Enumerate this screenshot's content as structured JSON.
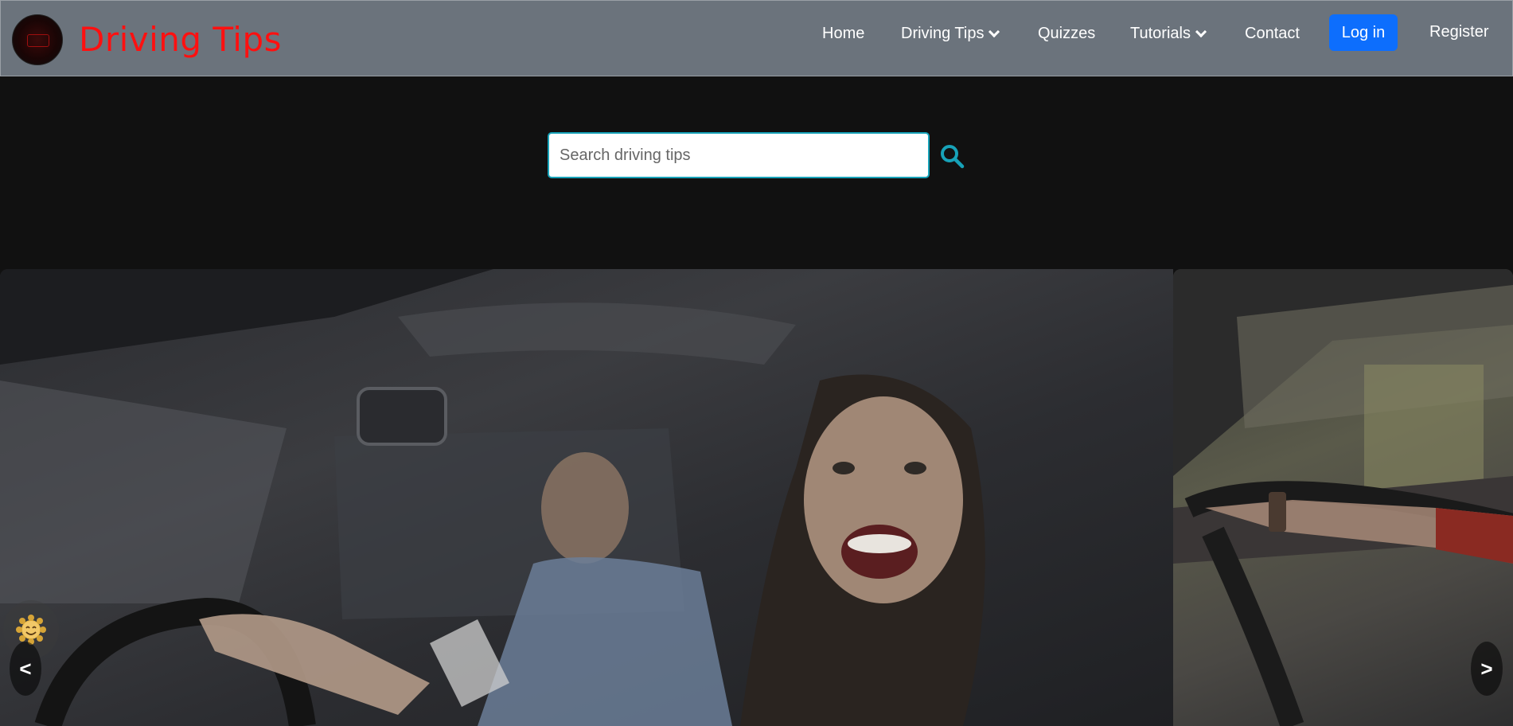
{
  "brand": {
    "name": "Driving Tips",
    "logo_icon": "driving-tips-logo",
    "color": "#ff1010"
  },
  "nav": {
    "items": [
      {
        "label": "Home"
      },
      {
        "label": "Driving Tips",
        "has_dropdown": true
      },
      {
        "label": "Quizzes"
      },
      {
        "label": "Tutorials",
        "has_dropdown": true
      },
      {
        "label": "Contact"
      }
    ],
    "login_label": "Log in",
    "register_label": "Register"
  },
  "search": {
    "placeholder": "Search driving tips",
    "value": "",
    "icon": "search-icon",
    "accent": "#17a2b8"
  },
  "carousel": {
    "prev_label": "<",
    "next_label": ">",
    "slides": [
      {
        "image": "woman-driving-with-instructor"
      },
      {
        "image": "hands-on-steering-wheel"
      }
    ]
  },
  "chat_widget": {
    "icon": "smiley-emoji-icon"
  },
  "colors": {
    "navbar": "#6b737c",
    "page_background": "#111111",
    "login_button": "#0d6efd"
  }
}
